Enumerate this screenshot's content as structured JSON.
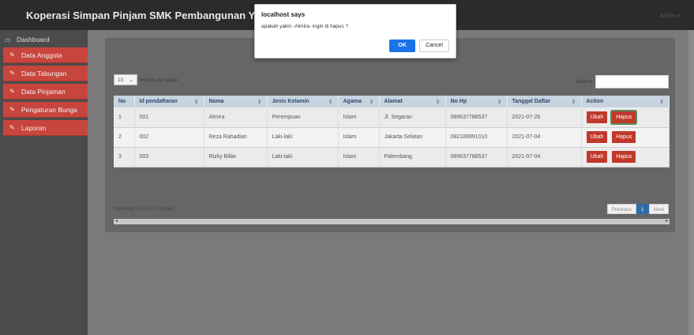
{
  "header": {
    "brand": "Koperasi Simpan Pinjam SMK Pembangunan YPT Palembang",
    "user_menu": "Admin ▾"
  },
  "sidebar": {
    "items": [
      {
        "label": "Dashboard",
        "icon": "monitor-icon"
      },
      {
        "label": "Data Anggota",
        "icon": "edit-icon"
      },
      {
        "label": "Data Tabungan",
        "icon": "edit-icon"
      },
      {
        "label": "Data Pinjaman",
        "icon": "edit-icon"
      },
      {
        "label": "Pengaturan Bunga",
        "icon": "edit-icon"
      },
      {
        "label": "Laporan",
        "icon": "edit-icon"
      }
    ]
  },
  "table_controls": {
    "length_value": "10",
    "length_suffix": "records per page",
    "search_label": "Search:",
    "search_value": ""
  },
  "table": {
    "columns": [
      "No",
      "Id pendaftaran",
      "Nama",
      "Jenis Kelamin",
      "Agama",
      "Alamat",
      "No Hp",
      "Tanggal Daftar",
      "Action"
    ],
    "rows": [
      [
        "1",
        "001",
        "Almira",
        "Perempuan",
        "Islam",
        "Jl. Segaran",
        "089637788537",
        "2021-07-26"
      ],
      [
        "2",
        "002",
        "Reza Rahadian",
        "Laki-laki",
        "Islam",
        "Jakarta Selatan",
        "082188991010",
        "2021-07-04"
      ],
      [
        "3",
        "003",
        "Rizky Billar",
        "Laki-laki",
        "Islam",
        "Palembang",
        "089637788537",
        "2021-07-04"
      ]
    ],
    "edit_label": "Ubah",
    "delete_label": "Hapus"
  },
  "footer": {
    "info": "Showing 1 to 3 of 3 entries",
    "prev": "Previous",
    "page": "1",
    "next": "Next"
  },
  "dialog": {
    "title": "localhost says",
    "message": "apakah yakin -Almira- ingin di hapus  ?",
    "ok": "OK",
    "cancel": "Cancel"
  },
  "colors": {
    "accent_red": "#c7453d",
    "topbar": "#2b2b2b",
    "ok_blue": "#1a73e8"
  }
}
